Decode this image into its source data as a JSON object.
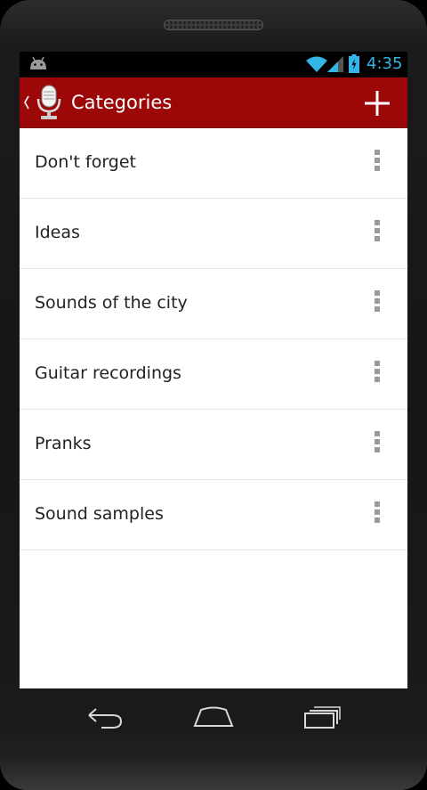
{
  "statusbar": {
    "time": "4:35"
  },
  "actionbar": {
    "title": "Categories"
  },
  "categories": [
    {
      "label": "Don't forget"
    },
    {
      "label": "Ideas"
    },
    {
      "label": "Sounds of the city"
    },
    {
      "label": "Guitar recordings"
    },
    {
      "label": "Pranks"
    },
    {
      "label": "Sound samples"
    }
  ],
  "colors": {
    "actionbar": "#9c0808",
    "clock": "#35b5e5",
    "list_bg": "#ffffff"
  },
  "icons": [
    "android-icon",
    "wifi-icon",
    "signal-icon",
    "battery-icon",
    "up-caret-icon",
    "microphone-icon",
    "plus-icon",
    "overflow-menu-icon",
    "back-icon",
    "home-icon",
    "recent-apps-icon"
  ]
}
